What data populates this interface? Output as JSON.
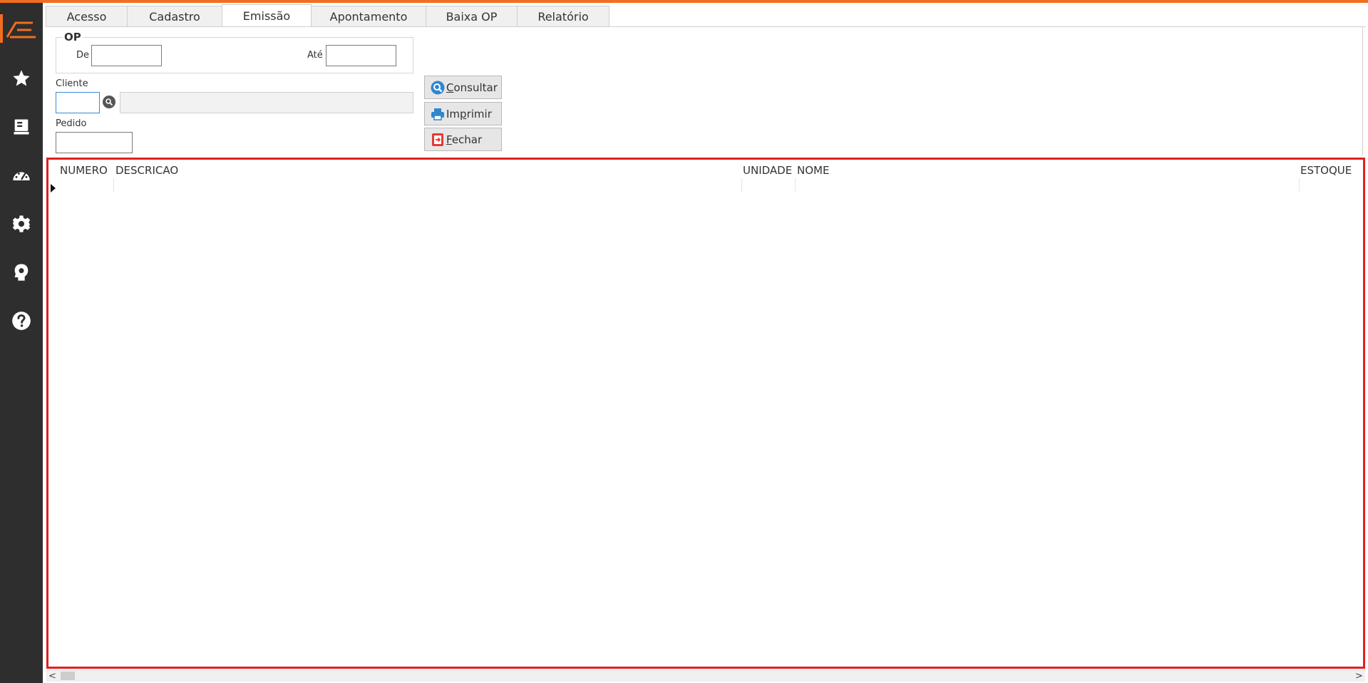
{
  "colors": {
    "accent": "#f26d1f",
    "sidebar": "#2e2e2e",
    "grid_border": "#e02020",
    "focus": "#3c8ad8"
  },
  "sidebar": {
    "icons": [
      "logo-icon",
      "star-icon",
      "screen-icon",
      "dashboard-icon",
      "gear-icon",
      "brain-gear-icon",
      "help-icon"
    ]
  },
  "tabs": [
    {
      "label": "Acesso",
      "active": false
    },
    {
      "label": "Cadastro",
      "active": false
    },
    {
      "label": "Emissão",
      "active": true
    },
    {
      "label": "Apontamento",
      "active": false
    },
    {
      "label": "Baixa OP",
      "active": false
    },
    {
      "label": "Relatório",
      "active": false
    }
  ],
  "form": {
    "op_group_title": "OP",
    "de_label": "De",
    "ate_label": "Até",
    "de_value": "",
    "ate_value": "",
    "cliente_label": "Cliente",
    "cliente_code": "",
    "cliente_name": "",
    "pedido_label": "Pedido",
    "pedido_value": ""
  },
  "buttons": {
    "consultar": {
      "hotkey": "C",
      "rest": "onsultar"
    },
    "imprimir": {
      "pre": "Im",
      "hotkey": "p",
      "rest": "rimir"
    },
    "fechar": {
      "hotkey": "F",
      "rest": "echar"
    }
  },
  "grid": {
    "columns": [
      "NUMERO",
      "DESCRICAO",
      "UNIDADE",
      "NOME",
      "ESTOQUE"
    ],
    "rows": []
  },
  "scrollbar": {
    "left_arrow": "<",
    "right_arrow": ">"
  }
}
